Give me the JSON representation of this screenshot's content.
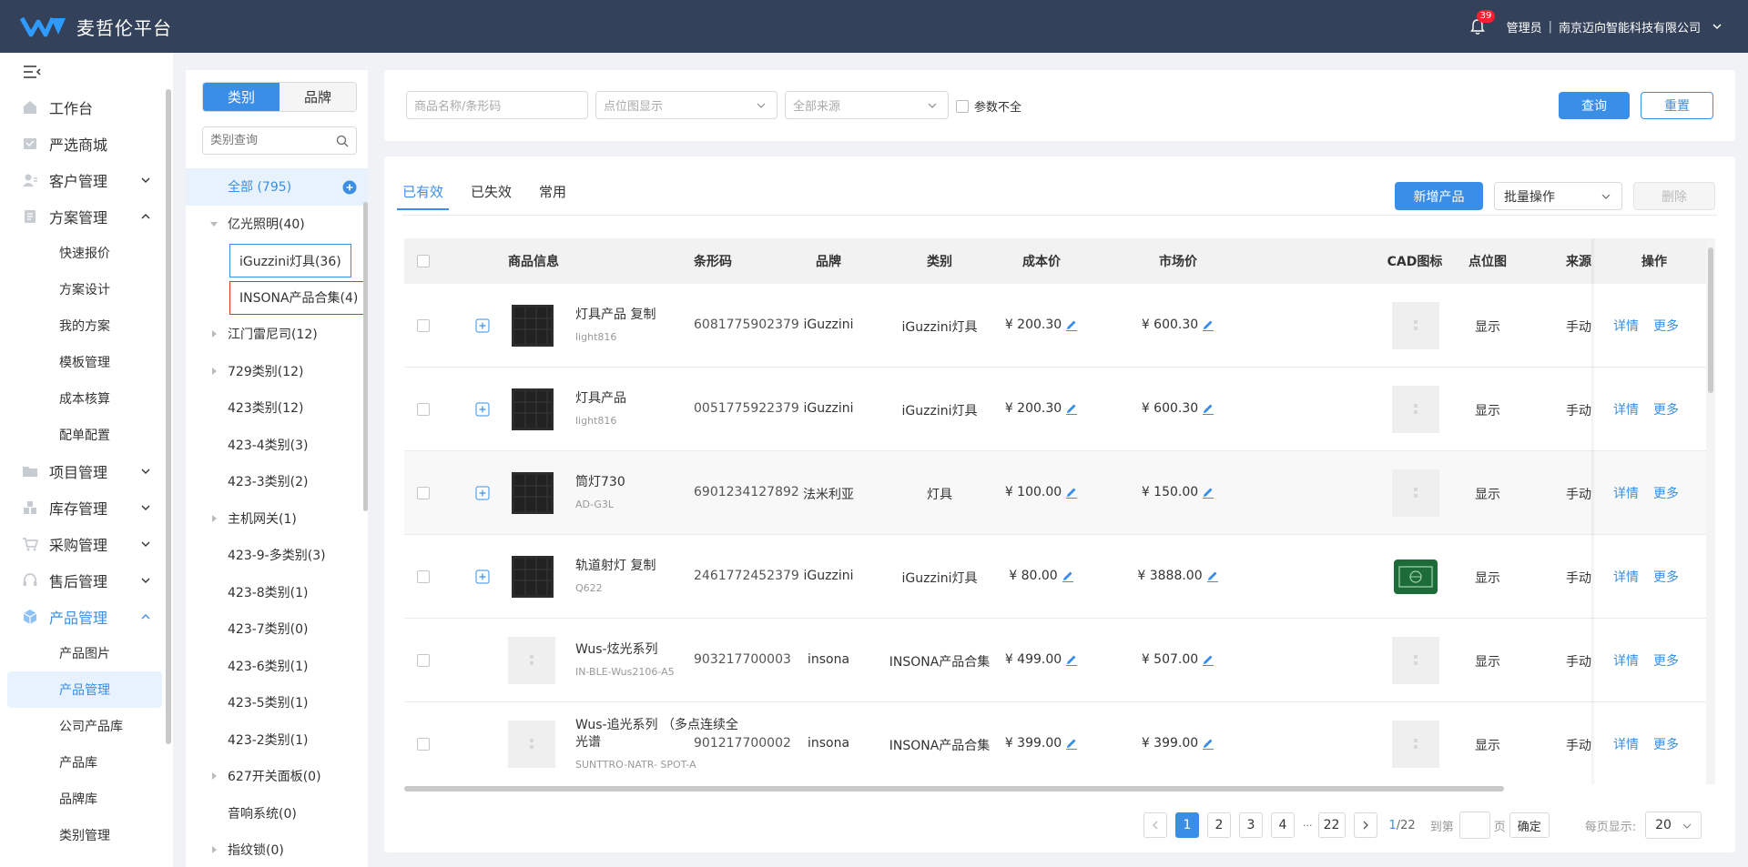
{
  "header": {
    "app_title": "麦哲伦平台",
    "notification_count": "39",
    "user_role": "管理员",
    "separator": "|",
    "company": "南京迈向智能科技有限公司"
  },
  "nav": {
    "items": [
      {
        "label": "工作台",
        "icon": "workbench-icon"
      },
      {
        "label": "严选商城",
        "icon": "mall-icon"
      },
      {
        "label": "客户管理",
        "icon": "customer-icon"
      },
      {
        "label": "方案管理",
        "icon": "plan-icon"
      },
      {
        "label": "项目管理",
        "icon": "folder-icon"
      },
      {
        "label": "库存管理",
        "icon": "inventory-icon"
      },
      {
        "label": "采购管理",
        "icon": "cart-icon"
      },
      {
        "label": "售后管理",
        "icon": "headset-icon"
      },
      {
        "label": "产品管理",
        "icon": "box-icon"
      }
    ],
    "plan_sub": [
      "快速报价",
      "方案设计",
      "我的方案",
      "模板管理",
      "成本核算",
      "配单配置"
    ],
    "product_sub": [
      "产品图片",
      "产品管理",
      "公司产品库",
      "产品库",
      "品牌库",
      "类别管理"
    ]
  },
  "category_panel": {
    "tab_category": "类别",
    "tab_brand": "品牌",
    "search_placeholder": "类别查询",
    "all": "全部 (795)",
    "tree": [
      {
        "label": "亿光照明(40)",
        "arrow": "down"
      },
      {
        "label": "iGuzzini灯具(36)",
        "child": true,
        "box": "blue"
      },
      {
        "label": "INSONA产品合集(4)",
        "child": true,
        "box": "red"
      },
      {
        "label": "江门雷尼司(12)",
        "arrow": "right"
      },
      {
        "label": "729类别(12)",
        "arrow": "right"
      },
      {
        "label": "423类别(12)",
        "arrow": "none"
      },
      {
        "label": "423-4类别(3)",
        "arrow": "none"
      },
      {
        "label": "423-3类别(2)",
        "arrow": "none"
      },
      {
        "label": "主机网关(1)",
        "arrow": "right"
      },
      {
        "label": "423-9-多类别(3)",
        "arrow": "none"
      },
      {
        "label": "423-8类别(1)",
        "arrow": "none"
      },
      {
        "label": "423-7类别(0)",
        "arrow": "none"
      },
      {
        "label": "423-6类别(1)",
        "arrow": "none"
      },
      {
        "label": "423-5类别(1)",
        "arrow": "none"
      },
      {
        "label": "423-2类别(1)",
        "arrow": "none"
      },
      {
        "label": "627开关面板(0)",
        "arrow": "right"
      },
      {
        "label": "音响系统(0)",
        "arrow": "none"
      },
      {
        "label": "指纹锁(0)",
        "arrow": "right"
      }
    ]
  },
  "filters": {
    "name_placeholder": "商品名称/条形码",
    "point_placeholder": "点位图显示",
    "source_placeholder": "全部来源",
    "incomplete_label": "参数不全",
    "query": "查询",
    "reset": "重置"
  },
  "main": {
    "tabs": [
      "已有效",
      "已失效",
      "常用"
    ],
    "add_product": "新增产品",
    "batch": "批量操作",
    "delete": "删除",
    "columns": {
      "info": "商品信息",
      "barcode": "条形码",
      "brand": "品牌",
      "category": "类别",
      "cost": "成本价",
      "market": "市场价",
      "cad": "CAD图标",
      "point": "点位图",
      "source": "来源",
      "ops": "操作"
    },
    "rows": [
      {
        "name": "灯具产品 复制",
        "code": "light816",
        "barcode": "6081775902379",
        "brand": "iGuzzini",
        "category": "iGuzzini灯具",
        "cost": "¥ 200.30",
        "market": "¥ 600.30",
        "point": "显示",
        "source": "手动",
        "detail": "详情",
        "more": "更多",
        "thumb": "dark",
        "cad": "light",
        "expand": true
      },
      {
        "name": "灯具产品",
        "code": "light816",
        "barcode": "0051775922379",
        "brand": "iGuzzini",
        "category": "iGuzzini灯具",
        "cost": "¥ 200.30",
        "market": "¥ 600.30",
        "point": "显示",
        "source": "手动",
        "detail": "详情",
        "more": "更多",
        "thumb": "dark",
        "cad": "light",
        "expand": true
      },
      {
        "name": "筒灯730",
        "code": "AD-G3L",
        "barcode": "6901234127892",
        "brand": "法米利亚",
        "category": "灯具",
        "cost": "¥ 100.00",
        "market": "¥ 150.00",
        "point": "显示",
        "source": "手动",
        "detail": "详情",
        "more": "更多",
        "thumb": "dark",
        "cad": "light",
        "expand": true
      },
      {
        "name": "轨道射灯 复制",
        "code": "Q622",
        "barcode": "2461772452379",
        "brand": "iGuzzini",
        "category": "iGuzzini灯具",
        "cost": "¥ 80.00",
        "market": "¥ 3888.00",
        "point": "显示",
        "source": "手动",
        "detail": "详情",
        "more": "更多",
        "thumb": "dark",
        "cad": "green",
        "expand": true
      },
      {
        "name": "Wus-炫光系列",
        "code": "IN-BLE-Wus2106-A5",
        "barcode": "903217700003",
        "brand": "insona",
        "category": "INSONA产品合集",
        "cost": "¥ 499.00",
        "market": "¥ 507.00",
        "point": "显示",
        "source": "手动",
        "detail": "详情",
        "more": "更多",
        "thumb": "light",
        "cad": "light",
        "expand": false
      },
      {
        "name": "Wus-追光系列 （多点连续全光谱",
        "code": "SUNTTRO-NATR- SPOT-A",
        "barcode": "901217700002",
        "brand": "insona",
        "category": "INSONA产品合集",
        "cost": "¥ 399.00",
        "market": "¥ 399.00",
        "point": "显示",
        "source": "手动",
        "detail": "详情",
        "more": "更多",
        "thumb": "light",
        "cad": "light",
        "expand": false
      }
    ]
  },
  "pagination": {
    "pages": [
      "1",
      "2",
      "3",
      "4"
    ],
    "ellipsis": "···",
    "last": "22",
    "current": "1",
    "total": "/22",
    "goto_label": "到第",
    "page_label": "页",
    "confirm": "确定",
    "per_page_label": "每页显示:",
    "per_page": "20"
  },
  "colors": {
    "primary": "#3a8ee6",
    "topbar": "#33425a",
    "highlight_red": "#e03131"
  }
}
